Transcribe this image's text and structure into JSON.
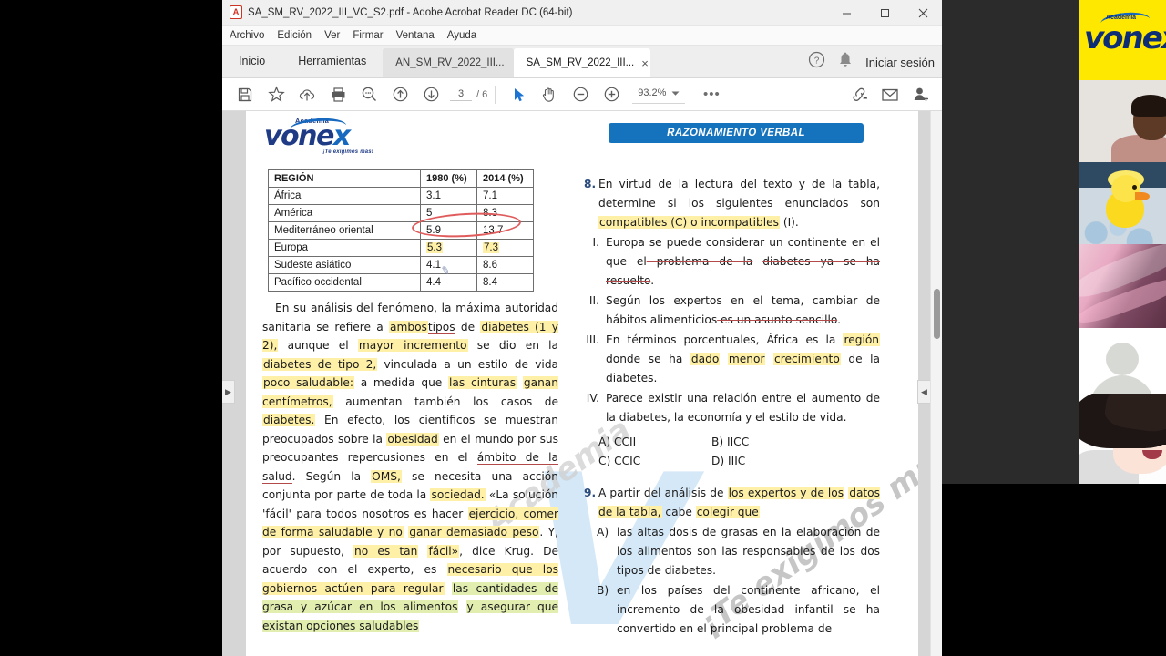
{
  "window": {
    "title": "SA_SM_RV_2022_III_VC_S2.pdf - Adobe Acrobat Reader DC (64-bit)",
    "pdf_badge": "A",
    "minimize": "minimize-button",
    "maximize": "maximize-button",
    "close": "close-button"
  },
  "menubar": {
    "items": [
      "Archivo",
      "Edición",
      "Ver",
      "Firmar",
      "Ventana",
      "Ayuda"
    ]
  },
  "tabstrip": {
    "nav": [
      "Inicio",
      "Herramientas"
    ],
    "docs": [
      {
        "label": "AN_SM_RV_2022_III...",
        "active": false,
        "close": ""
      },
      {
        "label": "SA_SM_RV_2022_III...",
        "active": true,
        "close": "×"
      }
    ],
    "help_icon": "?",
    "signin": "Iniciar sesión"
  },
  "toolbar": {
    "page_current": "3",
    "page_total": "/ 6",
    "zoom": "93.2%",
    "more": "•••",
    "icons": [
      "save-icon",
      "star-icon",
      "cloud-upload-icon",
      "print-icon",
      "search-icon",
      "previous-page-icon",
      "next-page-icon",
      "select-tool-icon",
      "hand-tool-icon",
      "zoom-out-icon",
      "zoom-in-icon"
    ]
  },
  "document": {
    "logo": {
      "academia": "Academia",
      "name_main": "vone",
      "name_x": "x",
      "tagline": "¡Te exigimos más!"
    },
    "banner": "RAZONAMIENTO VERBAL",
    "watermark_text": "¡Te exigimos más!",
    "watermark_letter": "V",
    "watermark_academia": "Academia",
    "table": {
      "headers": [
        "REGIÓN",
        "1980 (%)",
        "2014 (%)"
      ],
      "rows": [
        {
          "region": "África",
          "y1980": "3.1",
          "y2014": "7.1",
          "highlight": false
        },
        {
          "region": "América",
          "y1980": "5",
          "y2014": "8.3",
          "highlight": false
        },
        {
          "region": "Mediterráneo oriental",
          "y1980": "5.9",
          "y2014": "13.7",
          "highlight": false
        },
        {
          "region": "Europa",
          "y1980": "5.3",
          "y2014": "7.3",
          "highlight": true
        },
        {
          "region": "Sudeste asiático",
          "y1980": "4.1",
          "y2014": "8.6",
          "highlight": false
        },
        {
          "region": "Pacífico occidental",
          "y1980": "4.4",
          "y2014": "8.4",
          "highlight": false
        }
      ],
      "annotation_ellipse_color": "#e05b5b"
    },
    "questions": {
      "q8": {
        "number": "8.",
        "stem_a": "En virtud de la lectura del texto y de la tabla,",
        "stem_b": "determine si los siguientes enunciados son",
        "stem_c_hl": "compatibles (C) o incompatibles",
        "stem_c_end": " (I).",
        "items": [
          {
            "num": "I.",
            "t1": "Europa se puede considerar un",
            "t2": "continente en el que el",
            "t2s": " problema de la",
            "t3s": "diabetes ya se ha resuelto",
            "t3end": "."
          },
          {
            "num": "II.",
            "t1": "Según los expertos en el tema, cambiar de",
            "t2": "hábitos alimenticios",
            "t2s": " es un asunto sencillo",
            "t2end": "."
          },
          {
            "num": "III.",
            "t1": "En términos porcentuales, África es la",
            "t2hl1": "región",
            "t2mid": " donde se ha ",
            "t2hl2": "dado",
            "t2hl3": "menor",
            "t3hl": "crecimiento",
            "t3end": " de la diabetes."
          },
          {
            "num": "IV.",
            "t1": "Parece existir una relación entre el",
            "t2": "aumento de la diabetes, la economía y el",
            "t3": "estilo de vida."
          }
        ],
        "options": [
          "A) CCII",
          "B) IICC",
          "C) CCIC",
          "D) IIIC"
        ]
      },
      "q9": {
        "number": "9.",
        "stem_a": "A partir del análisis de ",
        "stem_a_hl": "los expertos y de los",
        "stem_b_hl": "datos de la tabla,",
        "stem_b_mid": " cabe ",
        "stem_b_hl2": "colegir que",
        "answers": [
          {
            "let": "A)",
            "l1": "las altas dosis de grasas en la elaboración",
            "l2": "de los alimentos son las responsables de",
            "l3": "los dos tipos de diabetes."
          },
          {
            "let": "B)",
            "l1": "en los países del continente africano, el",
            "l2": "incremento de la obesidad infantil se ha",
            "l3": "convertido en el principal problema de"
          }
        ]
      }
    },
    "paragraph": {
      "p1": "En su análisis del fenómeno, la máxima",
      "p2a": "autoridad sanitaria se refiere a ",
      "p2hl": "ambos",
      "p2ul": "tipos",
      "p2end": " de",
      "p3hl": "diabetes (1 y 2),",
      "p3mid": " aunque el ",
      "p3hl2": "mayor incremento",
      "p3end": " se",
      "p4a": "dio en la ",
      "p4hl": "diabetes de tipo 2,",
      "p4end": " vinculada a un estilo",
      "p5a": "de vida ",
      "p5hl": "poco saludable:",
      "p5mid": " a medida que ",
      "p5hl2": "las cinturas",
      "p6hl": "ganan centímetros,",
      "p6end": " aumentan también los casos",
      "p7a": "de  ",
      "p7hl": "diabetes.",
      "p7end": " En efecto, los científicos se",
      "p8a": "muestran preocupados sobre la ",
      "p8hl": "obesidad",
      "p8end": " en el",
      "p9": "mundo por sus preocupantes repercusiones en el",
      "p10ul": "ámbito de la salud",
      "p10mid": ". Según la ",
      "p10hl": "OMS,",
      "p10end": " se necesita",
      "p11": "una acción conjunta por parte de toda la",
      "p12hl": "sociedad.",
      "p12end": " «La solución 'fácil' para todos nosotros",
      "p13a": "es hacer ",
      "p13hl": "ejercicio, comer de forma saludable y no",
      "p14hl": "ganar demasiado peso",
      "p14mid": ". Y, por supuesto, ",
      "p14hl2": "no es tan",
      "p15hl": "fácil»",
      "p15end": ", dice Krug. De acuerdo con el experto, es",
      "p16hl": "necesario que los gobiernos actúen para regular",
      "p17hl": "las cantidades de grasa y azúcar en los alimentos",
      "p18hl": "y asegurar que existan opciones saludables"
    }
  },
  "rail": {
    "panes": [
      "vonex-logo-pane",
      "person-webcam-pane",
      "duckling-photo-pane",
      "pink-photo-pane",
      "default-avatar-pane",
      "anime-avatar-pane"
    ],
    "logo": {
      "academia": "Academia",
      "name": "vone",
      "x": "x"
    }
  },
  "colors": {
    "accent_blue": "#1573bd",
    "brand_navy": "#0d2d77",
    "highlight_yellow": "#fff0a8",
    "annotation_red": "#e05b5b",
    "rail_yellow": "#ffe800"
  }
}
